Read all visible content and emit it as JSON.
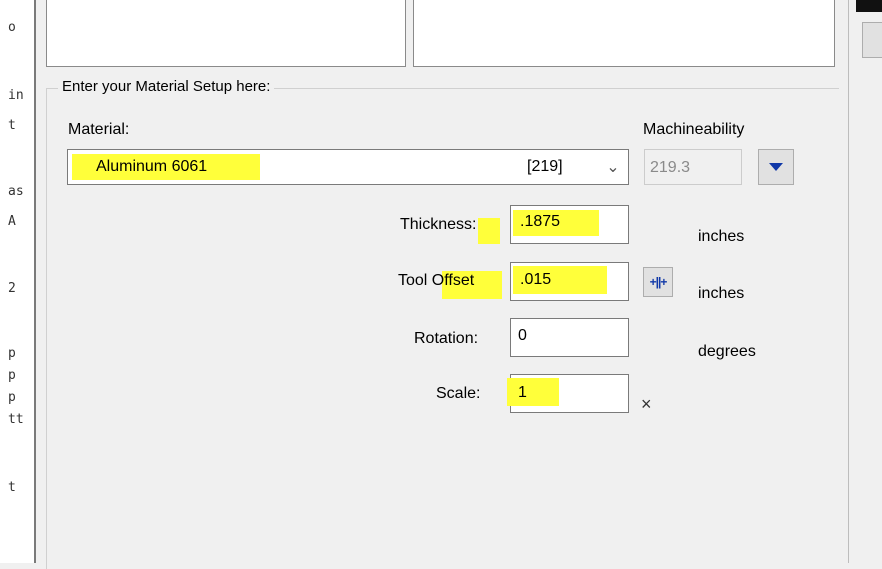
{
  "code_strip": [
    "o",
    "in",
    "t",
    "as",
    "A",
    "2",
    "p",
    "p",
    "p",
    "tt",
    "t"
  ],
  "material_setup": {
    "group_title": "Enter your Material Setup here:",
    "material_label": "Material:",
    "material_value": "Aluminum 6061",
    "material_code": "[219]",
    "machineability_label": "Machineability",
    "machineability_value": "219.3"
  },
  "fields": {
    "thickness": {
      "label": "Thickness:",
      "value": ".1875",
      "unit": "inches"
    },
    "tool_offset": {
      "label": "Tool Offset",
      "value": ".015",
      "unit": "inches",
      "button_glyph": "+||+"
    },
    "rotation": {
      "label": "Rotation:",
      "value": "0",
      "unit": "degrees"
    },
    "scale": {
      "label": "Scale:",
      "value": "1",
      "unit": "×"
    }
  },
  "colors": {
    "highlight": "#ffff3a",
    "accent_blue": "#1038a8"
  }
}
